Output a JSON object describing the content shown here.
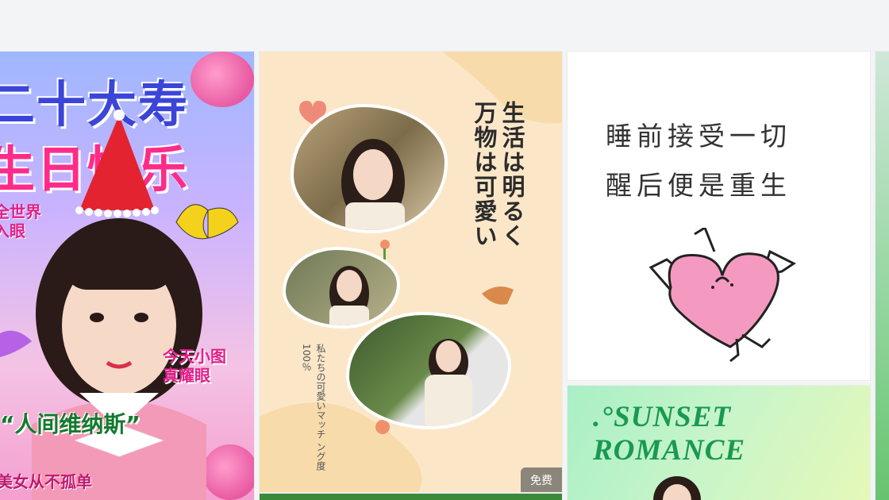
{
  "cards": [
    {
      "title_line1": "二十大寿",
      "title_line2": "生日快乐",
      "side_text_1": "全世界",
      "side_text_2": "入眼",
      "today_line1": "今天小图",
      "today_line2": "真耀眼",
      "quote": "“人间维纳斯”",
      "bottom": "美女从不孤单"
    },
    {
      "vtitle_1": "生活は明るく",
      "vtitle_2": "万物は可愛い",
      "vsub_1": "私たちの可愛いマッチ",
      "vsub_2": "ング度100％",
      "badge": "免费"
    },
    {
      "line1": "睡前接受一切",
      "line2": "醒后便是重生"
    },
    {
      "line1": ".°SUNSET",
      "line2": "ROMANCE"
    }
  ],
  "colors": {
    "page_bg": "#f3f4f6",
    "accent_pink": "#ff2b8a",
    "accent_blue": "#3b45d8",
    "accent_green": "#1a9950",
    "heart_pink": "#f49ac0"
  },
  "icons": {
    "butterfly": "butterfly-icon",
    "party_hat": "party-hat-icon",
    "heart_character": "heart-character-icon",
    "bird": "bird-icon",
    "flower": "flower-icon"
  }
}
